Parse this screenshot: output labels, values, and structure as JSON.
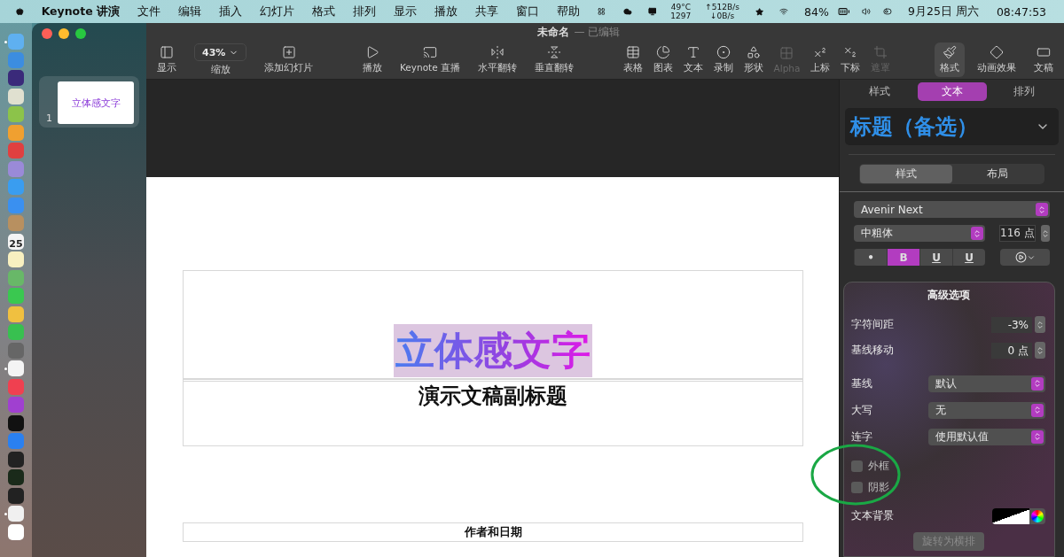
{
  "menu_bar": {
    "app": "Keynote 讲演",
    "menus": [
      "文件",
      "编辑",
      "插入",
      "幻灯片",
      "格式",
      "排列",
      "显示",
      "播放",
      "共享",
      "窗口",
      "帮助"
    ],
    "temp": "49°C",
    "fan": "1297",
    "upload": "↑512B/s",
    "download": "↓0B/s",
    "battery": "84%",
    "date": "9月25日 周六",
    "time": "08:47:53"
  },
  "dock": {
    "items": [
      {
        "running": true
      },
      {
        "running": false
      },
      {
        "running": false
      },
      {
        "running": false
      },
      {
        "running": false
      },
      {
        "running": false
      },
      {
        "running": false
      },
      {
        "running": false
      },
      {
        "running": false
      },
      {
        "running": false
      },
      {
        "running": false
      },
      {
        "running": false,
        "label": "25"
      },
      {
        "running": false
      },
      {
        "running": false
      },
      {
        "running": false
      },
      {
        "running": false
      },
      {
        "running": false
      },
      {
        "running": false
      },
      {
        "running": true
      },
      {
        "running": false
      },
      {
        "running": false
      },
      {
        "running": false
      },
      {
        "running": false
      },
      {
        "running": false
      },
      {
        "running": false
      },
      {
        "running": false
      },
      {
        "running": true
      },
      {
        "running": false
      }
    ]
  },
  "window": {
    "title": "未命名",
    "status": "— 已编辑"
  },
  "toolbar": {
    "groups": [
      [
        {
          "label": "显示",
          "selected": false,
          "disabled": false
        },
        {
          "label": "缩放",
          "value": "43%",
          "selected": false,
          "disabled": false
        },
        {
          "label": "添加幻灯片",
          "selected": false,
          "disabled": false
        }
      ],
      [
        {
          "label": "播放",
          "selected": false,
          "disabled": false
        },
        {
          "label": "Keynote 直播",
          "selected": false,
          "disabled": false
        },
        {
          "label": "水平翻转",
          "selected": false,
          "disabled": false
        },
        {
          "label": "垂直翻转",
          "selected": false,
          "disabled": false
        }
      ],
      [
        {
          "label": "表格",
          "selected": false,
          "disabled": false
        },
        {
          "label": "图表",
          "selected": false,
          "disabled": false
        },
        {
          "label": "文本",
          "selected": false,
          "disabled": false
        },
        {
          "label": "录制",
          "selected": false,
          "disabled": false
        },
        {
          "label": "形状",
          "selected": false,
          "disabled": false
        },
        {
          "label": "Alpha",
          "selected": false,
          "disabled": true
        },
        {
          "label": "上标",
          "selected": false,
          "disabled": false
        },
        {
          "label": "下标",
          "selected": false,
          "disabled": false
        },
        {
          "label": "遮罩",
          "selected": false,
          "disabled": true
        }
      ],
      [
        {
          "label": "格式",
          "selected": true,
          "disabled": false
        },
        {
          "label": "动画效果",
          "selected": false,
          "disabled": false
        },
        {
          "label": "文稿",
          "selected": false,
          "disabled": false
        }
      ]
    ]
  },
  "navigator": {
    "slides": [
      {
        "number": "1",
        "title": "立体感文字",
        "selected": true
      }
    ]
  },
  "slide": {
    "title": "立体感文字",
    "title_selected": true,
    "subtitle": "演示文稿副标题",
    "footer": "作者和日期"
  },
  "inspector": {
    "tabs": [
      {
        "label": "样式",
        "selected": false
      },
      {
        "label": "文本",
        "selected": true
      },
      {
        "label": "排列",
        "selected": false
      }
    ],
    "paragraph_style": "标题（备选）",
    "segments": [
      {
        "label": "样式",
        "selected": true
      },
      {
        "label": "布局",
        "selected": false
      }
    ],
    "font": "Avenir Next",
    "weight": "中粗体",
    "size": "116 点",
    "style_buttons": [
      {
        "label": "•",
        "selected": false
      },
      {
        "label": "B",
        "selected": true
      },
      {
        "label": "U",
        "selected": false
      },
      {
        "label": "U",
        "selected": false
      }
    ]
  },
  "advanced": {
    "title": "高级选项",
    "steppers": [
      {
        "label": "字符间距",
        "value": "-3%"
      },
      {
        "label": "基线移动",
        "value": "0 点"
      }
    ],
    "selects": [
      {
        "label": "基线",
        "value": "默认"
      },
      {
        "label": "大写",
        "value": "无"
      },
      {
        "label": "连字",
        "value": "使用默认值"
      }
    ],
    "checkboxes": [
      {
        "label": "外框",
        "checked": false
      },
      {
        "label": "阴影",
        "checked": false
      }
    ],
    "background_label": "文本背景",
    "button": {
      "label": "旋转为横排",
      "disabled": true
    }
  }
}
